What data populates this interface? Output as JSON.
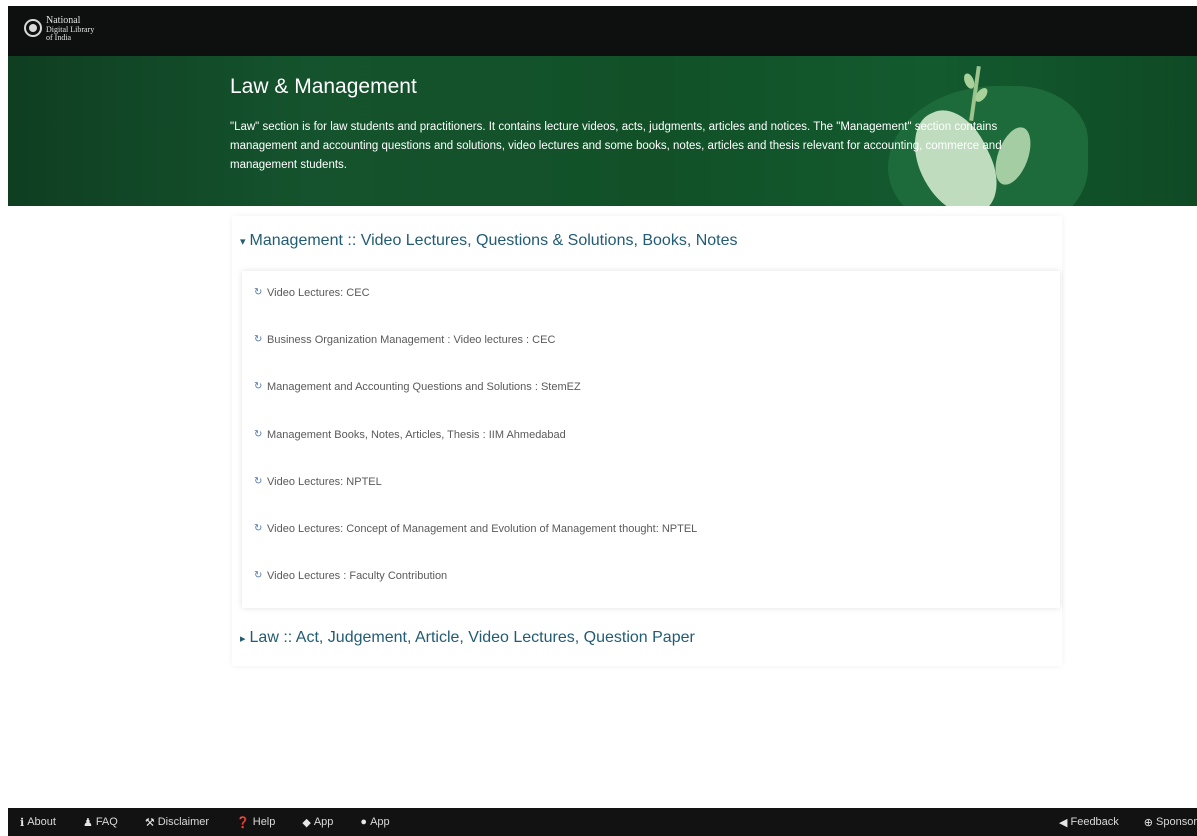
{
  "brand": {
    "line1": "National",
    "line2": "Digital Library",
    "line3": "of India"
  },
  "hero": {
    "title": "Law & Management",
    "description": "\"Law\" section is for law students and practitioners. It contains lecture videos, acts, judgments, articles and notices. The \"Management\" section contains management and accounting questions and solutions, video lectures and some books, notes, articles and thesis relevant for accounting, commerce and management students."
  },
  "sections": {
    "management": {
      "caret": "▾",
      "title": "Management :: Video Lectures, Questions & Solutions, Books, Notes",
      "items": [
        "Video Lectures: CEC",
        "Business Organization Management : Video lectures : CEC",
        "Management and Accounting Questions and Solutions : StemEZ",
        "Management Books, Notes, Articles, Thesis : IIM Ahmedabad",
        "Video Lectures: NPTEL",
        "Video Lectures: Concept of Management and Evolution of Management thought: NPTEL",
        "Video Lectures : Faculty Contribution"
      ]
    },
    "law": {
      "caret": "▸",
      "title": "Law :: Act, Judgement, Article, Video Lectures, Question Paper"
    }
  },
  "footer": {
    "left": [
      {
        "icon": "info-icon",
        "glyph": "ℹ",
        "label": "About"
      },
      {
        "icon": "faq-icon",
        "glyph": "♟",
        "label": "FAQ"
      },
      {
        "icon": "gavel-icon",
        "glyph": "⚒",
        "label": "Disclaimer"
      },
      {
        "icon": "help-icon",
        "glyph": "❓",
        "label": "Help"
      },
      {
        "icon": "android-icon",
        "glyph": "◆",
        "label": "App"
      },
      {
        "icon": "apple-icon",
        "glyph": "●",
        "label": "App"
      }
    ],
    "right": [
      {
        "icon": "bullhorn-icon",
        "glyph": "◀",
        "label": "Feedback"
      },
      {
        "icon": "sponsor-icon",
        "glyph": "⊕",
        "label": "Sponsor"
      }
    ]
  },
  "colors": {
    "topbar": "#0e0f0f",
    "hero_green": "#14532d",
    "section_heading": "#225c74",
    "link_icon": "#5078a8",
    "footer": "#121212"
  }
}
